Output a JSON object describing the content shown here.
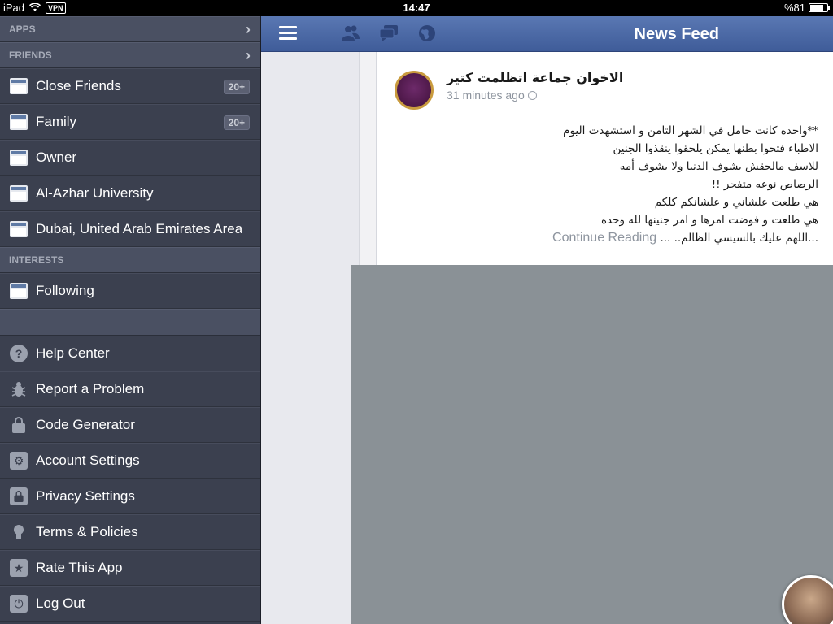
{
  "status_bar": {
    "device": "iPad",
    "vpn": "VPN",
    "time": "14:47",
    "battery": "%81",
    "battery_fraction": 0.81
  },
  "sidebar": {
    "apps_header": "APPS",
    "friends_header": "FRIENDS",
    "friends_items": [
      {
        "label": "Close Friends",
        "badge": "20+"
      },
      {
        "label": "Family",
        "badge": "20+"
      },
      {
        "label": "Owner"
      },
      {
        "label": "Al-Azhar University"
      },
      {
        "label": "Dubai, United Arab Emirates Area"
      }
    ],
    "interests_header": "INTERESTS",
    "interests_items": [
      {
        "label": "Following"
      }
    ],
    "settings_items": [
      {
        "label": "Help Center",
        "icon": "help-icon"
      },
      {
        "label": "Report a Problem",
        "icon": "bug-icon"
      },
      {
        "label": "Code Generator",
        "icon": "lock-icon"
      },
      {
        "label": "Account Settings",
        "icon": "gear-icon"
      },
      {
        "label": "Privacy Settings",
        "icon": "privacy-lock-icon"
      },
      {
        "label": "Terms & Policies",
        "icon": "terms-icon"
      },
      {
        "label": "Rate This App",
        "icon": "star-icon"
      },
      {
        "label": "Log Out",
        "icon": "power-icon"
      }
    ]
  },
  "topbar": {
    "title": "News Feed",
    "icons": [
      "menu-icon",
      "friend-requests-icon",
      "messages-icon",
      "notifications-globe-icon"
    ]
  },
  "story": {
    "author": "الاخوان جماعة اتظلمت كتير",
    "time": "31 minutes ago",
    "text_lines": [
      "**واحده كانت حامل في الشهر الثامن و استشهدت اليوم",
      "الاطباء فتحوا بطنها يمكن يلحقوا ينقذوا الجنين",
      "للاسف مالحقش يشوف الدنيا ولا يشوف أمه",
      "الرصاص نوعه متفجر !!",
      "هي طلعت علشاني و علشانكم كلكم",
      "هي طلعت و فوضت امرها و امر جنينها لله وحده",
      "...اللهم عليك بالسيسي الظالم.. ..."
    ],
    "continue_label": "Continue Reading"
  },
  "colors": {
    "sidebar_bg": "#3b404f",
    "topbar": "#4a67a4",
    "feed_bg": "#e8e9ee"
  }
}
